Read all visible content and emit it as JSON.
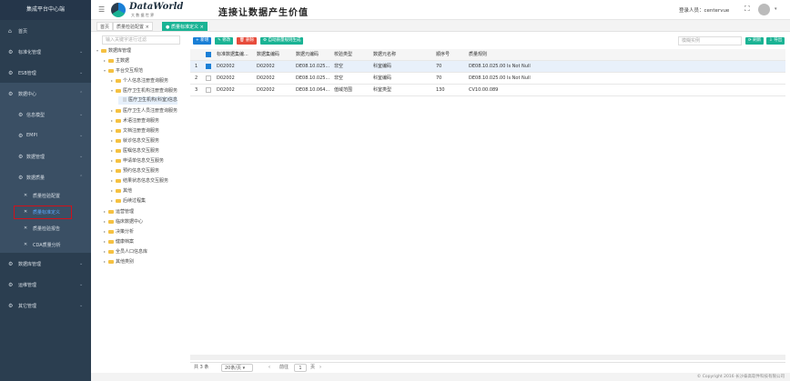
{
  "sidebar": {
    "title": "集成平台中心端",
    "items": [
      {
        "label": "首页",
        "icon": "home-icon"
      },
      {
        "label": "标准化管理",
        "icon": "gear-icon"
      },
      {
        "label": "ESB管理",
        "icon": "gear-icon"
      },
      {
        "label": "数据中心",
        "icon": "gear-icon"
      },
      {
        "label": "信息模型",
        "icon": "gear-icon"
      },
      {
        "label": "EMPI",
        "icon": "gear-icon"
      },
      {
        "label": "数据管理",
        "icon": "gear-icon"
      },
      {
        "label": "数据质量",
        "icon": "gear-icon"
      },
      {
        "label": "质量检验配置",
        "icon": "wrench-icon"
      },
      {
        "label": "质量标准定义",
        "icon": "wrench-icon"
      },
      {
        "label": "质量检验报告",
        "icon": "wrench-icon"
      },
      {
        "label": "CDA质量分析",
        "icon": "wrench-icon"
      },
      {
        "label": "数据库管理",
        "icon": "gear-icon"
      },
      {
        "label": "运维管理",
        "icon": "gear-icon"
      },
      {
        "label": "其它管理",
        "icon": "gear-icon"
      }
    ]
  },
  "header": {
    "logo": "DataWorld",
    "logo_sub": "大 数 据 世 界",
    "slogan": "连接让数据产生价值",
    "user_label": "登录人员：centervue"
  },
  "tabs": [
    {
      "label": "首页"
    },
    {
      "label": "质量检验配置"
    },
    {
      "label": "质量标准定义"
    }
  ],
  "tree": {
    "search_placeholder": "输入关键字进行过滤",
    "nodes": [
      "数据库管理",
      "主数据",
      "平台交互规范",
      "个人信息注册查询服务",
      "医疗卫生机构注册查询服务",
      "医疗卫生机构(科室)信息",
      "医疗卫生人员注册查询服务",
      "术语注册查询服务",
      "文档注册查询服务",
      "就诊信息交互服务",
      "医嘱信息交互服务",
      "申请单信息交互服务",
      "预约信息交互服务",
      "结果状态信息交互服务",
      "其他",
      "后续过程集",
      "运营管理",
      "临床数据中心",
      "决策分析",
      "健康档案",
      "全员人口信息库",
      "其他类别"
    ]
  },
  "toolbar": {
    "add": "新增",
    "edit": "修改",
    "delete": "删除",
    "generate": "自动质量规则生成",
    "search_placeholder": "模糊实例",
    "refresh": "刷新",
    "export": "导出"
  },
  "table": {
    "headers": [
      "",
      "",
      "标准数据集编...",
      "数据集编码",
      "数据元编码",
      "校验类型",
      "数据元名称",
      "顺序号",
      "质量规则"
    ],
    "rows": [
      [
        "1",
        "D02002",
        "D02002",
        "DE08.10.025...",
        "非空",
        "科室编码",
        "70",
        "DE08.10.025.00 Is Not Null"
      ],
      [
        "2",
        "D02002",
        "D02002",
        "DE08.10.025...",
        "非空",
        "科室编码",
        "70",
        "DE08.10.025.00 Is Not Null"
      ],
      [
        "3",
        "D02002",
        "D02002",
        "DE08.10.064...",
        "值域范围",
        "科室类型",
        "130",
        "CV10.00.089"
      ]
    ]
  },
  "pager": {
    "total": "共 3 条",
    "page_size": "20条/页",
    "goto_label": "前往",
    "page": "1",
    "page_suffix": "页"
  },
  "copyright": "© Copyright 2016 长沙泰高软件科技有限公司",
  "colors": {
    "sidebar": "#2b3e50",
    "accent": "#1ab394",
    "primary": "#1a7fd6",
    "danger": "#e74c3c"
  }
}
